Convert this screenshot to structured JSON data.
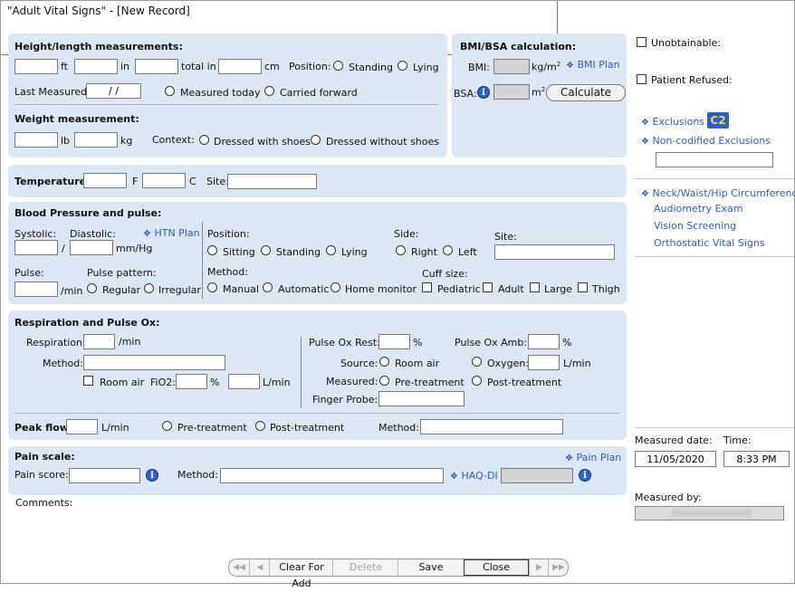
{
  "window": {
    "title": "\"Adult Vital Signs\" - [New Record]"
  },
  "height": {
    "header": "Height/length measurements:",
    "ft": "ft",
    "in": "in",
    "total_in": "total in",
    "cm": "cm",
    "position_label": "Position:",
    "standing": "Standing",
    "lying": "Lying",
    "last_measured_label": "Last Measured:",
    "last_measured_value": "/ /",
    "measured_today": "Measured today",
    "carried_forward": "Carried forward"
  },
  "weight": {
    "header": "Weight measurement:",
    "lb": "lb",
    "kg": "kg",
    "context_label": "Context:",
    "dressed_with_shoes": "Dressed with shoes",
    "dressed_without_shoes": "Dressed without shoes"
  },
  "bmi": {
    "header": "BMI/BSA calculation:",
    "bmi_label": "BMI:",
    "bmi_unit": "kg/m",
    "bmi_unit_sup": "2",
    "bmi_plan": "BMI Plan",
    "bsa_label": "BSA:",
    "bsa_unit": "m",
    "bsa_unit_sup": "2",
    "calculate": "Calculate"
  },
  "side": {
    "unobtainable": "Unobtainable:",
    "patient_refused": "Patient Refused:",
    "exclusions": "Exclusions",
    "c2_badge": "C2",
    "non_codified_exclusions": "Non-codified Exclusions",
    "links": [
      "Neck/Waist/Hip Circumference",
      "Audiometry Exam",
      "Vision Screening",
      "Orthostatic Vital Signs"
    ],
    "measured_date_label": "Measured date:",
    "measured_date_value": "11/05/2020",
    "time_label": "Time:",
    "time_value": "8:33 PM",
    "measured_by_label": "Measured by:"
  },
  "temperature": {
    "label": "Temperature:",
    "f": "F",
    "c": "C",
    "site": "Site:"
  },
  "bp": {
    "header": "Blood Pressure and pulse:",
    "systolic": "Systolic:",
    "diastolic": "Diastolic:",
    "htn_plan": "HTN Plan",
    "slash": "/",
    "unit": "mm/Hg",
    "pulse": "Pulse:",
    "pulse_unit": "/min",
    "pulse_pattern": "Pulse pattern:",
    "regular": "Regular",
    "irregular": "Irregular",
    "position_label": "Position:",
    "sitting": "Sitting",
    "standing": "Standing",
    "lying": "Lying",
    "side_label": "Side:",
    "right": "Right",
    "left": "Left",
    "site_label": "Site:",
    "method_label": "Method:",
    "manual": "Manual",
    "automatic": "Automatic",
    "home_monitor": "Home monitor",
    "cuff_size_label": "Cuff size:",
    "pediatric": "Pediatric",
    "adult": "Adult",
    "large": "Large",
    "thigh": "Thigh"
  },
  "resp": {
    "header": "Respiration and Pulse Ox:",
    "respiration": "Respiration:",
    "resp_unit": "/min",
    "method": "Method:",
    "room_air": "Room air",
    "fio2": "FiO2:",
    "pct": "%",
    "lmin": "L/min",
    "pulse_ox_rest": "Pulse Ox Rest:",
    "pulse_ox_amb": "Pulse Ox Amb:",
    "source_label": "Source:",
    "source_room_air": "Room air",
    "oxygen": "Oxygen:",
    "measured_label": "Measured:",
    "pre_treatment": "Pre-treatment",
    "post_treatment": "Post-treatment",
    "finger_probe": "Finger Probe:"
  },
  "peak": {
    "label": "Peak flow:",
    "unit": "L/min",
    "pre_treatment": "Pre-treatment",
    "post_treatment": "Post-treatment",
    "method": "Method:"
  },
  "pain": {
    "header": "Pain scale:",
    "pain_plan": "Pain Plan",
    "score": "Pain score:",
    "method": "Method:",
    "haq_di": "HAQ-DI"
  },
  "comments_label": "Comments:",
  "toolbar": {
    "first": "◀◀",
    "prev": "◀",
    "clear_for_add": "Clear For Add",
    "delete": "Delete",
    "save": "Save",
    "close": "Close",
    "next": "▶",
    "last": "▶▶"
  },
  "colors": {
    "panel": "#dde7f3",
    "link": "#2b60c4",
    "info_icon": "#2b63c8"
  }
}
